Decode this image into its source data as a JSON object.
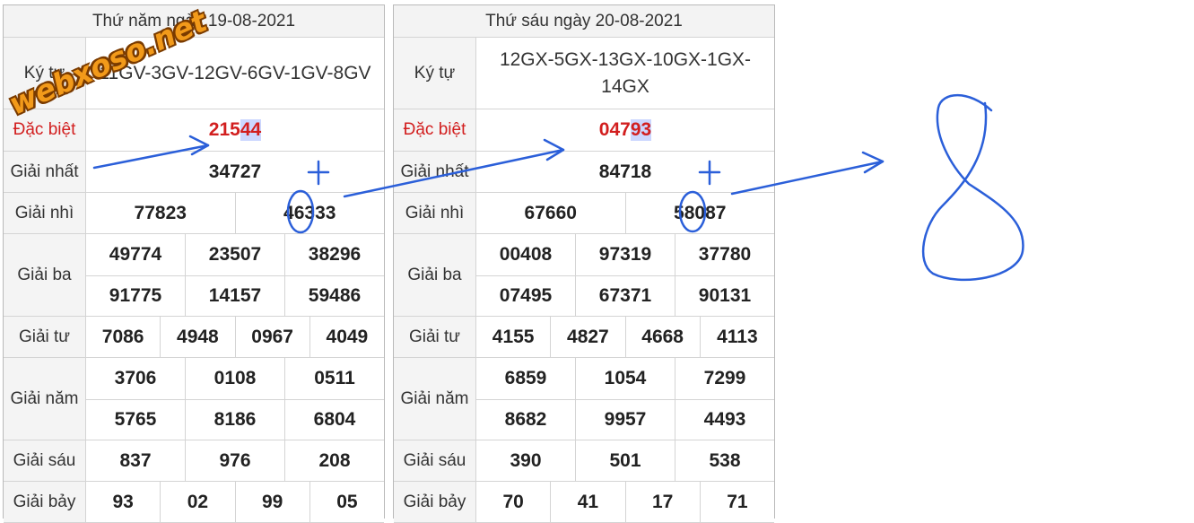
{
  "watermark": "webxoso.net",
  "colors": {
    "special_red": "#d21f1f",
    "annotation_blue": "#2b5fd9",
    "watermark_orange": "#f29a1a"
  },
  "left": {
    "header": "Thứ năm ngày 19-08-2021",
    "kytu_label": "Ký tự",
    "kytu_value": "11GV-3GV-12GV-6GV-1GV-8GV",
    "special_label": "Đặc biệt",
    "special_prefix": "215",
    "special_highlight": "44",
    "rows": [
      {
        "label": "Giải nhất",
        "lines": [
          [
            "34727"
          ]
        ]
      },
      {
        "label": "Giải nhì",
        "lines": [
          [
            "77823",
            "46333"
          ]
        ]
      },
      {
        "label": "Giải ba",
        "lines": [
          [
            "49774",
            "23507",
            "38296"
          ],
          [
            "91775",
            "14157",
            "59486"
          ]
        ]
      },
      {
        "label": "Giải tư",
        "lines": [
          [
            "7086",
            "4948",
            "0967",
            "4049"
          ]
        ]
      },
      {
        "label": "Giải năm",
        "lines": [
          [
            "3706",
            "0108",
            "0511"
          ],
          [
            "5765",
            "8186",
            "6804"
          ]
        ]
      },
      {
        "label": "Giải sáu",
        "lines": [
          [
            "837",
            "976",
            "208"
          ]
        ]
      },
      {
        "label": "Giải bảy",
        "lines": [
          [
            "93",
            "02",
            "99",
            "05"
          ]
        ]
      }
    ]
  },
  "right": {
    "header": "Thứ sáu ngày 20-08-2021",
    "kytu_label": "Ký tự",
    "kytu_value": "12GX-5GX-13GX-10GX-1GX-14GX",
    "special_label": "Đặc biệt",
    "special_prefix": "047",
    "special_highlight": "93",
    "rows": [
      {
        "label": "Giải nhất",
        "lines": [
          [
            "84718"
          ]
        ]
      },
      {
        "label": "Giải nhì",
        "lines": [
          [
            "67660",
            "58087"
          ]
        ]
      },
      {
        "label": "Giải ba",
        "lines": [
          [
            "00408",
            "97319",
            "37780"
          ],
          [
            "07495",
            "67371",
            "90131"
          ]
        ]
      },
      {
        "label": "Giải tư",
        "lines": [
          [
            "4155",
            "4827",
            "4668",
            "4113"
          ]
        ]
      },
      {
        "label": "Giải năm",
        "lines": [
          [
            "6859",
            "1054",
            "7299"
          ],
          [
            "8682",
            "9957",
            "4493"
          ]
        ]
      },
      {
        "label": "Giải sáu",
        "lines": [
          [
            "390",
            "501",
            "538"
          ]
        ]
      },
      {
        "label": "Giải bảy",
        "lines": [
          [
            "70",
            "41",
            "17",
            "71"
          ]
        ]
      }
    ]
  },
  "annotations": {
    "plus_sign": "+",
    "result": "8"
  }
}
